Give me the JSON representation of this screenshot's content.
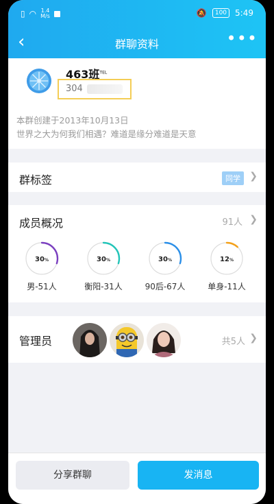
{
  "status": {
    "speed_top": "1.4",
    "speed_unit": "M/s",
    "battery": "100",
    "time": "5:49"
  },
  "nav": {
    "title": "群聊资料",
    "more": "•••"
  },
  "group": {
    "name": "463班",
    "name_tag": "TEL",
    "id_prefix": "304",
    "created": "本群创建于2013年10月13日",
    "motto": "世界之大为何我们相遇？难道是缘分难道是天意"
  },
  "tags": {
    "label": "群标签",
    "badge": "同学"
  },
  "members": {
    "label": "成员概况",
    "count": "91人",
    "stats": [
      {
        "pct": "30",
        "unit": "%",
        "label": "男-51人",
        "fraction": 0.3,
        "color": "#7a3fbf"
      },
      {
        "pct": "30",
        "unit": "%",
        "label": "衡阳-31人",
        "fraction": 0.3,
        "color": "#22c4b8"
      },
      {
        "pct": "30",
        "unit": "%",
        "label": "90后-67人",
        "fraction": 0.3,
        "color": "#2b8fe8"
      },
      {
        "pct": "12",
        "unit": "%",
        "label": "单身-11人",
        "fraction": 0.12,
        "color": "#f3a11b"
      }
    ]
  },
  "admins": {
    "label": "管理员",
    "count": "共5人"
  },
  "actions": {
    "share": "分享群聊",
    "send": "发消息"
  }
}
